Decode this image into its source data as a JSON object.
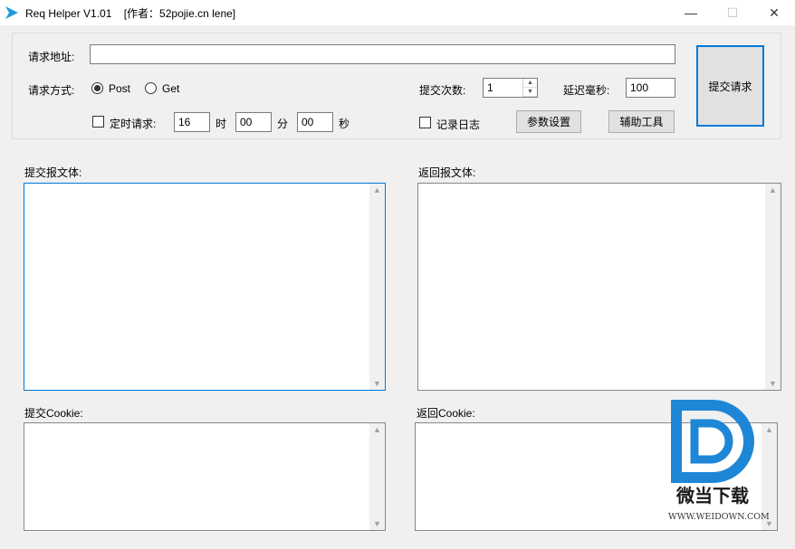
{
  "window": {
    "title": "Req Helper V1.01    [作者：52pojie.cn lene]",
    "minimize": "—",
    "maximize": "☐",
    "close": "✕"
  },
  "request": {
    "url_label": "请求地址:",
    "url_value": "",
    "method_label": "请求方式:",
    "method_options": [
      "Post",
      "Get"
    ],
    "method_selected": "Post",
    "timed_label": "定时请求:",
    "hour": "16",
    "hour_unit": "时",
    "minute": "00",
    "minute_unit": "分",
    "second": "00",
    "second_unit": "秒",
    "count_label": "提交次数:",
    "count_value": "1",
    "delay_label": "延迟毫秒:",
    "delay_value": "100",
    "log_label": "记录日志",
    "params_button": "参数设置",
    "tools_button": "辅助工具",
    "submit_button": "提交请求"
  },
  "panels": {
    "submit_body_label": "提交报文体:",
    "response_body_label": "返回报文体:",
    "submit_cookie_label": "提交Cookie:",
    "response_cookie_label": "返回Cookie:"
  },
  "watermark": {
    "brand": "微当下载",
    "url": "WWW.WEIDOWN.COM"
  },
  "colors": {
    "accent": "#0078d7",
    "watermark_blue": "#1e86d6"
  }
}
